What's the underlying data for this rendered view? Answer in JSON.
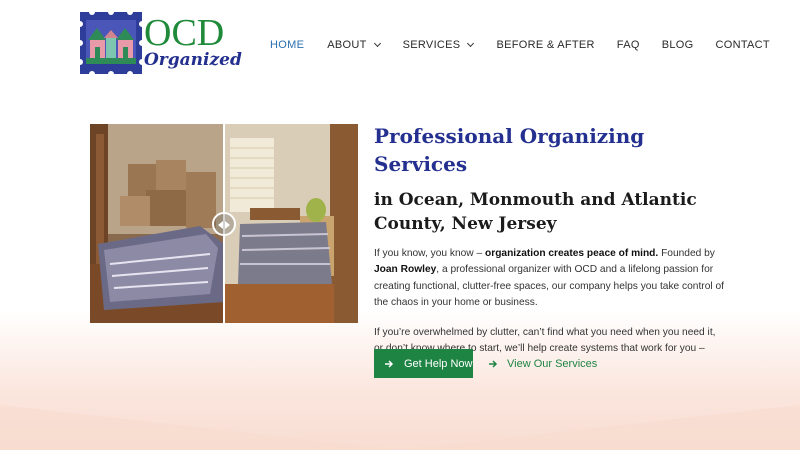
{
  "brand": {
    "logo_line1": "OCD",
    "logo_line2": "Organized",
    "colors": {
      "green": "#1f8a3a",
      "navy": "#24308f",
      "accent_blue": "#2a6fb0"
    }
  },
  "nav": {
    "items": [
      {
        "label": "HOME",
        "active": true,
        "dropdown": false
      },
      {
        "label": "ABOUT",
        "active": false,
        "dropdown": true
      },
      {
        "label": "SERVICES",
        "active": false,
        "dropdown": true
      },
      {
        "label": "BEFORE & AFTER",
        "active": false,
        "dropdown": false
      },
      {
        "label": "FAQ",
        "active": false,
        "dropdown": false
      },
      {
        "label": "BLOG",
        "active": false,
        "dropdown": false
      },
      {
        "label": "CONTACT",
        "active": false,
        "dropdown": false
      }
    ]
  },
  "hero": {
    "title": "Professional Organizing Services",
    "subtitle": "in Ocean, Monmouth and Atlantic County, New Jersey",
    "para1": {
      "text_a": "If you know, you know – ",
      "bold_a": "organization creates peace of mind.",
      "text_b": " Founded by ",
      "bold_b": "Joan Rowley",
      "text_c": ", a professional organizer with OCD and a lifelong passion for creating functional, clutter-free spaces, our company helps you take control of the chaos in your home or business."
    },
    "para2": "If you’re overwhelmed by clutter, can’t find what you need when you need it, or don’t know where to start, we’ll help create systems that work for you – without judgment.",
    "cta_primary": "Get Help Now",
    "cta_secondary": "View Our Services",
    "image_icons": [
      "before-after-compare-icon"
    ]
  }
}
